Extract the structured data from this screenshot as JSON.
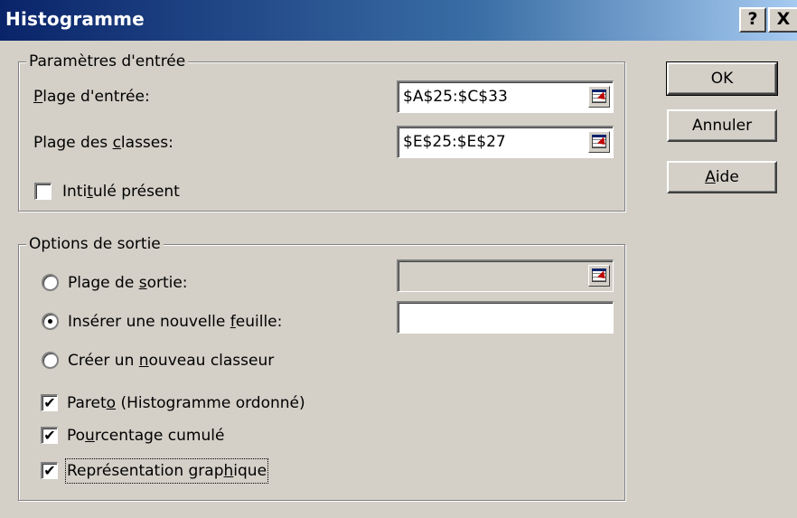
{
  "window": {
    "title": "Histogramme",
    "help_glyph": "?",
    "close_glyph": "X"
  },
  "input_params": {
    "legend": "Paramètres d'entrée",
    "input_range": {
      "label_first": "P",
      "label_rest": "lage d'entrée:",
      "value": "$A$25:$C$33"
    },
    "bin_range": {
      "label_pre": "Plage des ",
      "label_u": "c",
      "label_post": "lasses:",
      "value": "$E$25:$E$27"
    },
    "labels_check": {
      "label_pre": "Inti",
      "label_u": "t",
      "label_post": "ulé présent",
      "checked": false
    }
  },
  "output_options": {
    "legend": "Options de sortie",
    "output_range": {
      "label_pre": "Plage de ",
      "label_u": "s",
      "label_post": "ortie:",
      "value": "",
      "selected": false
    },
    "new_sheet": {
      "label_pre": "Insérer une nouvelle ",
      "label_u": "f",
      "label_post": "euille:",
      "value": "",
      "selected": true
    },
    "new_workbook": {
      "label_pre": "Créer un ",
      "label_u": "n",
      "label_post": "ouveau classeur",
      "selected": false
    },
    "pareto": {
      "label_pre": "Paret",
      "label_u": "o",
      "label_post": " (Histogramme ordonné)",
      "checked": true
    },
    "cumulative": {
      "label_pre": "Po",
      "label_u": "u",
      "label_post": "rcentage cumulé",
      "checked": true
    },
    "chart": {
      "label_pre": "Représentation grap",
      "label_u": "h",
      "label_post": "ique",
      "checked": true
    }
  },
  "buttons": {
    "ok": "OK",
    "cancel": "Annuler",
    "help_u": "A",
    "help_rest": "ide"
  },
  "check_glyph": "✔"
}
